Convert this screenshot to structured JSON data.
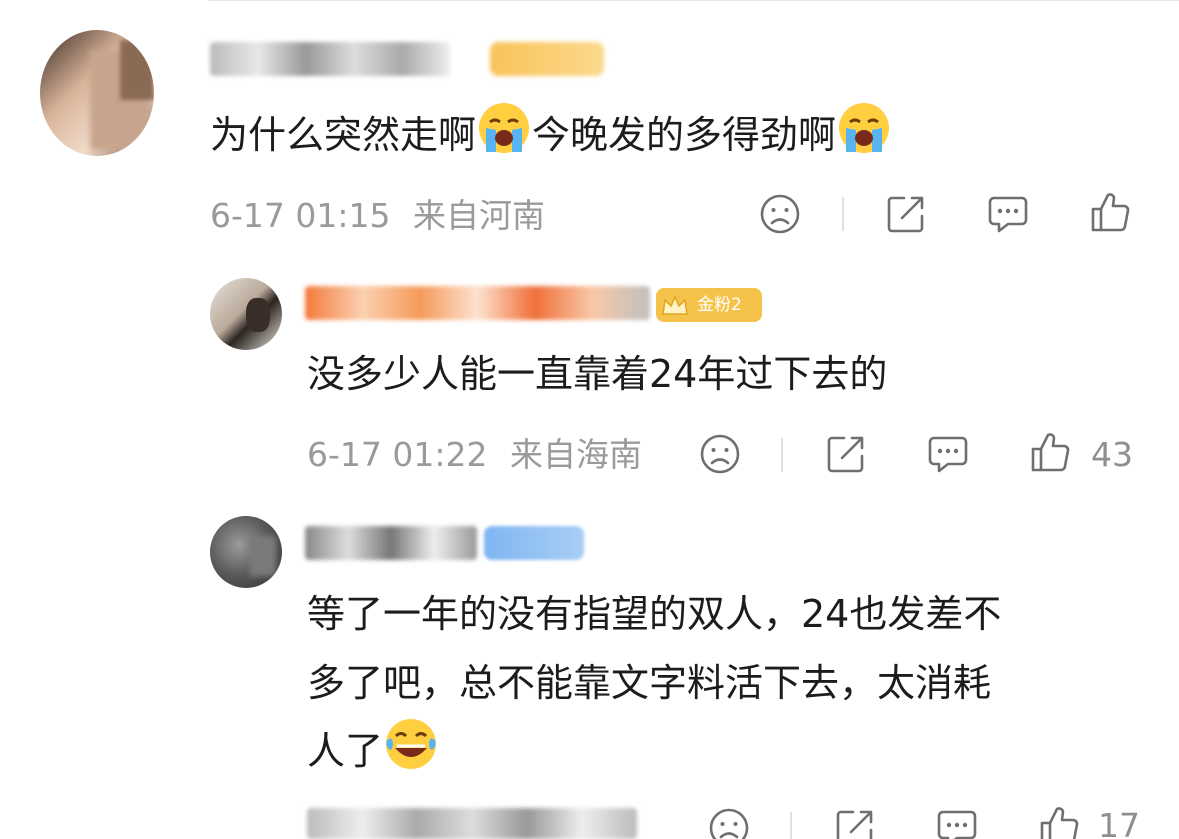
{
  "comments": [
    {
      "body": "为什么突然走啊",
      "body_tail": "今晚发的多得劲啊",
      "date": "6-17 01:15",
      "location": "来自河南"
    },
    {
      "badge": "金粉2",
      "body": "没多少人能一直靠着24年过下去的",
      "date": "6-17 01:22",
      "location": "来自海南",
      "likes": "43"
    },
    {
      "body_lines": [
        "等了一年的没有指望的双人，24也发差不",
        "多了吧，总不能靠文字料活下去，太消耗",
        "人了"
      ],
      "likes": "17"
    }
  ],
  "icons": {
    "dislike": "sad-face-icon",
    "share": "share-icon",
    "comment": "comment-bubble-icon",
    "like": "thumbs-up-icon"
  },
  "colors": {
    "meta_text": "#9a9a9a",
    "badge_gold": "#f5c34a",
    "badge_blue": "#7fb6f2"
  }
}
